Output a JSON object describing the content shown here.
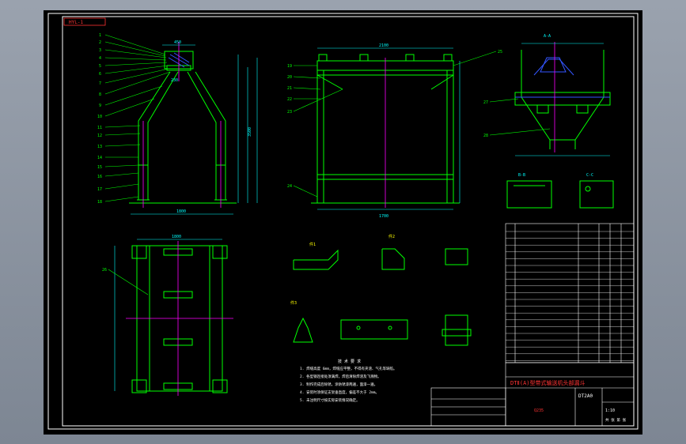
{
  "sheet": {
    "corner_tag": "HYL-1",
    "title_block_title": "DTⅡ(A)型带式输送机头部漏斗",
    "drawing_number": "DT2A0",
    "scale_label": "1:10",
    "material_label": "Q235",
    "sheet_label": "共 张 第 张"
  },
  "balloons": [
    "1",
    "2",
    "3",
    "4",
    "5",
    "6",
    "7",
    "8",
    "9",
    "10",
    "11",
    "12",
    "13",
    "14",
    "15",
    "16",
    "17",
    "18",
    "19",
    "20",
    "21",
    "22",
    "23",
    "24",
    "25",
    "26",
    "27",
    "28"
  ],
  "dimensions": {
    "front_top": "450",
    "front_mid": "230",
    "front_bottom": "1800",
    "front_height": "3500",
    "side_top": "2100",
    "side_bottom": "1700",
    "plan_width": "1800",
    "section_a": "A-A",
    "section_b": "B-B",
    "section_c": "C-C",
    "detail_1": "件1",
    "detail_2": "件2",
    "detail_3": "件3"
  },
  "notes": {
    "heading": "技 术 要 求",
    "lines": [
      "1. 焊缝高度 6mm，焊缝应平整，不得有夹渣、气孔等缺陷。",
      "2. 各型钢连接处须满焊，焊后清除焊渣及飞溅物。",
      "3. 制作完成后除锈，涂防锈漆两遍，面漆一遍。",
      "4. 安装时须保证支架垂直度，偏差不大于 2mm。",
      "5. 未注明尺寸按实际安装情况确定。"
    ]
  },
  "colors": {
    "frame_line": "#ffffff",
    "geometry": "#00ff00",
    "centerline": "#ff00ff",
    "dimension": "#00ffff",
    "leader": "#00ff00",
    "hatch": "#0000ff",
    "text_yellow": "#ffff00",
    "title_red": "#ff3333"
  }
}
